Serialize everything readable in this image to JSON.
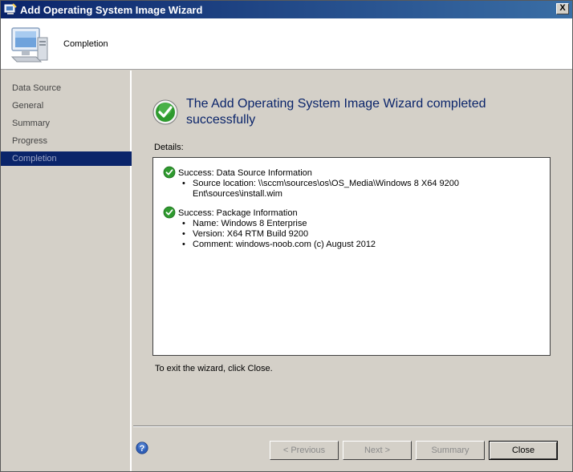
{
  "window": {
    "title": "Add Operating System Image Wizard",
    "close_symbol": "X"
  },
  "header": {
    "page_title": "Completion",
    "icon": "computer-icon"
  },
  "nav": {
    "items": [
      {
        "label": "Data Source"
      },
      {
        "label": "General"
      },
      {
        "label": "Summary"
      },
      {
        "label": "Progress"
      },
      {
        "label": "Completion",
        "active": true
      }
    ]
  },
  "main": {
    "headline": "The Add Operating System Image Wizard completed successfully",
    "details_label": "Details:",
    "details": [
      {
        "heading": "Success: Data Source Information",
        "lines": [
          "Source location: \\\\sccm\\sources\\os\\OS_Media\\Windows 8 X64 9200 Ent\\sources\\install.wim"
        ]
      },
      {
        "heading": "Success: Package Information",
        "lines": [
          "Name: Windows 8 Enterprise",
          "Version: X64 RTM Build 9200",
          "Comment: windows-noob.com (c) August 2012"
        ]
      }
    ],
    "exit_text": "To exit the wizard, click Close."
  },
  "buttons": {
    "previous": "< Previous",
    "next": "Next >",
    "summary": "Summary",
    "close": "Close"
  },
  "colors": {
    "title_bar": "#0a246a",
    "headline": "#0a246a",
    "success_green": "#2e9a2e"
  }
}
